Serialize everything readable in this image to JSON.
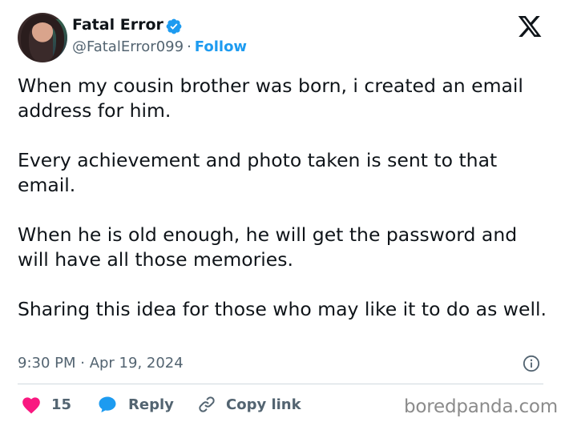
{
  "author": {
    "display_name": "Fatal Error",
    "handle": "@FatalError099",
    "separator": "·",
    "follow_label": "Follow",
    "verified": true,
    "avatar_icon": "profile-avatar"
  },
  "tweet": {
    "paragraphs": [
      "When my cousin brother was born, i created an email address for him.",
      "Every achievement and photo taken is sent to that email.",
      "When he is old enough, he will get the password and will have all those memories.",
      "Sharing this idea for those who may like it to do as well."
    ],
    "timestamp": "9:30 PM · Apr 19, 2024"
  },
  "actions": {
    "like_count": "15",
    "reply_label": "Reply",
    "copy_link_label": "Copy link"
  },
  "watermark": "boredpanda.com",
  "colors": {
    "accent": "#1d9bf0",
    "like": "#f91880",
    "text": "#0f1419",
    "muted": "#536471"
  }
}
